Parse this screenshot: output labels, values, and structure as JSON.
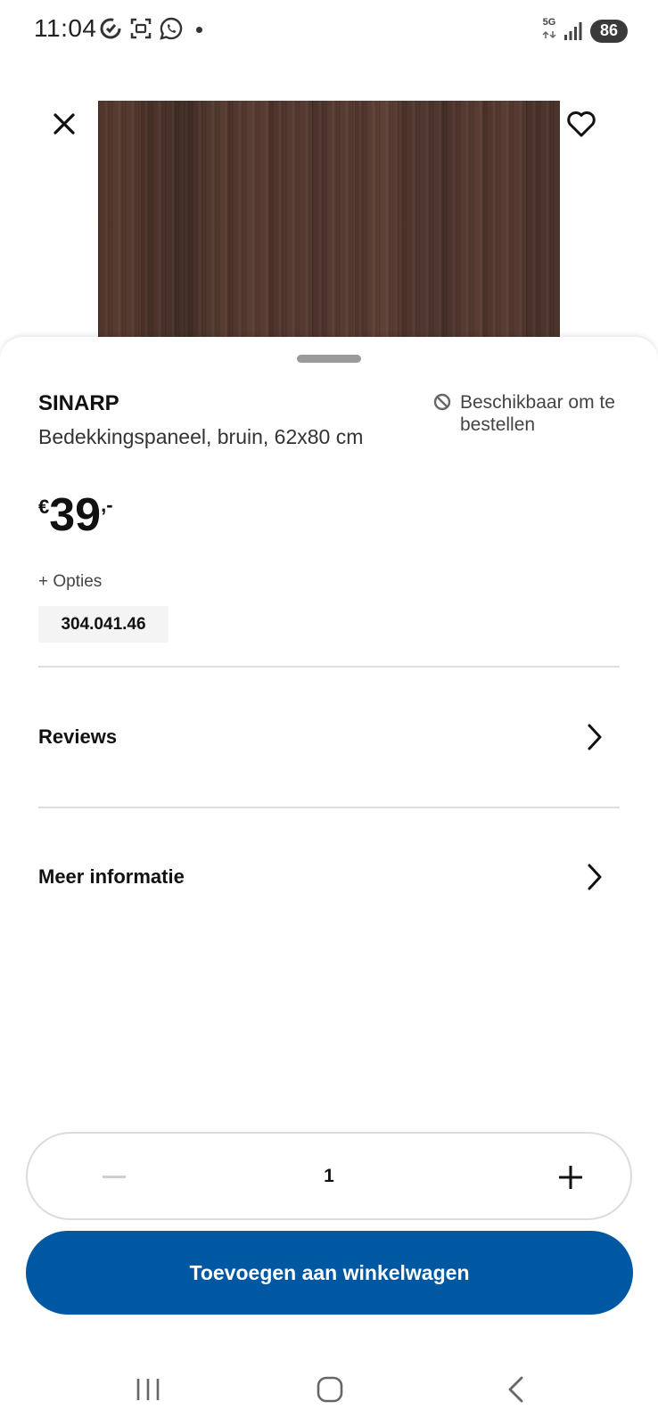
{
  "status_bar": {
    "time": "11:04",
    "network": "5G",
    "battery": "86",
    "left_icons": [
      "sync-icon",
      "screenshot-icon",
      "whatsapp-icon",
      "notification-dot"
    ],
    "right_icons": [
      "5g-icon",
      "signal-icon",
      "battery-icon"
    ]
  },
  "header": {
    "close_icon": "close-icon",
    "favorite_icon": "heart-icon"
  },
  "product": {
    "name": "SINARP",
    "description": "Bedekkingspaneel, bruin, 62x80 cm",
    "availability": "Beschikbaar om te bestellen",
    "availability_icon": "unavailable-icon",
    "price": {
      "currency": "€",
      "amount": "39",
      "suffix": ",-"
    },
    "options_label": "+ Opties",
    "article_number": "304.041.46"
  },
  "sections": [
    {
      "label": "Reviews"
    },
    {
      "label": "Meer informatie"
    }
  ],
  "quantity": {
    "value": "1",
    "minus_enabled": false
  },
  "cta": {
    "label": "Toevoegen aan winkelwagen"
  },
  "colors": {
    "brand_blue": "#0058a3",
    "wood_brown": "#563a31",
    "divider": "#dedede",
    "article_bg": "#f4f4f4"
  },
  "nav_bar": [
    "recent-apps-icon",
    "home-icon",
    "back-icon"
  ]
}
